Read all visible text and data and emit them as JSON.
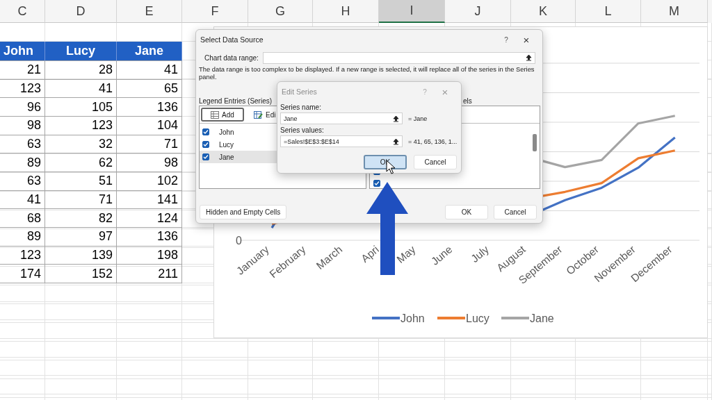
{
  "columns": [
    {
      "label": "C",
      "selected": false
    },
    {
      "label": "D",
      "selected": false
    },
    {
      "label": "E",
      "selected": false
    },
    {
      "label": "F",
      "selected": false
    },
    {
      "label": "G",
      "selected": false
    },
    {
      "label": "H",
      "selected": false
    },
    {
      "label": "I",
      "selected": true
    },
    {
      "label": "J",
      "selected": false
    },
    {
      "label": "K",
      "selected": false
    },
    {
      "label": "L",
      "selected": false
    },
    {
      "label": "M",
      "selected": false
    }
  ],
  "table": {
    "headers": [
      "John",
      "Lucy",
      "Jane"
    ],
    "rows": [
      [
        "21",
        "28",
        "41"
      ],
      [
        "123",
        "41",
        "65"
      ],
      [
        "96",
        "105",
        "136"
      ],
      [
        "98",
        "123",
        "104"
      ],
      [
        "63",
        "32",
        "71"
      ],
      [
        "89",
        "62",
        "98"
      ],
      [
        "63",
        "51",
        "102"
      ],
      [
        "41",
        "71",
        "141"
      ],
      [
        "68",
        "82",
        "124"
      ],
      [
        "89",
        "97",
        "136"
      ],
      [
        "123",
        "139",
        "198"
      ],
      [
        "174",
        "152",
        "211"
      ]
    ]
  },
  "chart": {
    "zero_label": "0",
    "categories": [
      "January",
      "February",
      "March",
      "Apri",
      "May",
      "June",
      "July",
      "August",
      "September",
      "October",
      "November",
      "December"
    ],
    "legend": [
      {
        "name": "John",
        "color": "#4472c4"
      },
      {
        "name": "Lucy",
        "color": "#ed7d31"
      },
      {
        "name": "Jane",
        "color": "#a5a5a5"
      }
    ]
  },
  "select_data_source": {
    "title": "Select Data Source",
    "help": "?",
    "close": "×",
    "chart_data_range": {
      "label": "Chart data range:"
    },
    "message": "The data range is too complex to be displayed. If a new range is selected, it will replace all of the series in the Series panel.",
    "legend_entries": {
      "label": "Legend Entries (Series)",
      "buttons": [
        {
          "label": "Add",
          "kind": "add",
          "focused": true
        },
        {
          "label": "Edi",
          "kind": "edit",
          "focused": false
        }
      ],
      "items": [
        {
          "label": "John",
          "checked": true,
          "selected": false
        },
        {
          "label": "Lucy",
          "checked": true,
          "selected": false
        },
        {
          "label": "Jane",
          "checked": true,
          "selected": true
        }
      ]
    },
    "axis_labels": {
      "label": "els",
      "items": [
        {
          "checked": true
        },
        {
          "checked": true
        }
      ]
    },
    "hidden_cells_button": "Hidden and Empty Cells",
    "buttons": [
      "OK",
      "Cancel"
    ]
  },
  "edit_series": {
    "title": "Edit Series",
    "help": "?",
    "close": "×",
    "fields": [
      {
        "label": "Series name:",
        "value": "Jane",
        "result": "= Jane"
      },
      {
        "label": "Series values:",
        "value": "=Sales!$E$3:$E$14",
        "result": "= 41, 65, 136, 1..."
      }
    ],
    "buttons": [
      {
        "label": "OK",
        "focused": true
      },
      {
        "label": "Cancel",
        "focused": false
      }
    ]
  }
}
